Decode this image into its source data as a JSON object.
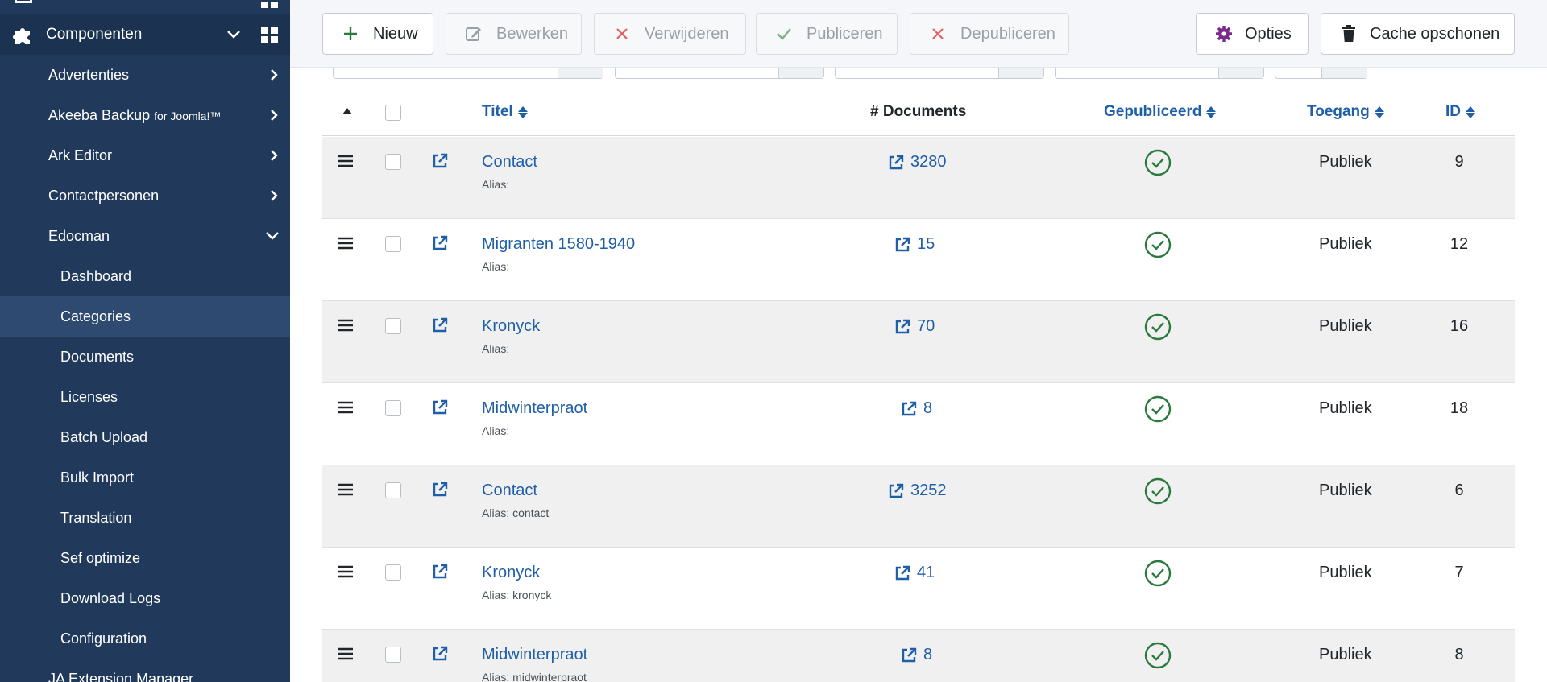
{
  "sidebar": {
    "section_label": "Componenten",
    "items": [
      {
        "label": "Advertenties",
        "level": 1,
        "icon": "chevron-right-icon"
      },
      {
        "label": "Akeeba Backup",
        "suffix": "for Joomla!™",
        "level": 1,
        "icon": "chevron-right-icon"
      },
      {
        "label": "Ark Editor",
        "level": 1,
        "icon": "chevron-right-icon"
      },
      {
        "label": "Contactpersonen",
        "level": 1,
        "icon": "chevron-right-icon"
      },
      {
        "label": "Edocman",
        "level": 1,
        "icon": "chevron-down-icon"
      },
      {
        "label": "Dashboard",
        "level": 2
      },
      {
        "label": "Categories",
        "level": 2,
        "active": true
      },
      {
        "label": "Documents",
        "level": 2
      },
      {
        "label": "Licenses",
        "level": 2
      },
      {
        "label": "Batch Upload",
        "level": 2
      },
      {
        "label": "Bulk Import",
        "level": 2
      },
      {
        "label": "Translation",
        "level": 2
      },
      {
        "label": "Sef optimize",
        "level": 2
      },
      {
        "label": "Download Logs",
        "level": 2
      },
      {
        "label": "Configuration",
        "level": 2
      },
      {
        "label": "JA Extension Manager",
        "level": 1
      }
    ]
  },
  "toolbar": {
    "new_label": "Nieuw",
    "edit_label": "Bewerken",
    "delete_label": "Verwijderen",
    "publish_label": "Publiceren",
    "unpublish_label": "Depubliceren",
    "options_label": "Opties",
    "cache_label": "Cache opschonen"
  },
  "table": {
    "headers": {
      "title": "Titel",
      "documents": "# Documents",
      "published": "Gepubliceerd",
      "access": "Toegang",
      "id": "ID"
    },
    "rows": [
      {
        "title": "Contact",
        "alias": "Alias:",
        "documents": "3280",
        "access": "Publiek",
        "id": "9"
      },
      {
        "title": "Migranten 1580-1940",
        "alias": "Alias:",
        "documents": "15",
        "access": "Publiek",
        "id": "12"
      },
      {
        "title": "Kronyck",
        "alias": "Alias:",
        "documents": "70",
        "access": "Publiek",
        "id": "16"
      },
      {
        "title": "Midwinterpraot",
        "alias": "Alias:",
        "documents": "8",
        "access": "Publiek",
        "id": "18"
      },
      {
        "title": "Contact",
        "alias": "Alias: contact",
        "documents": "3252",
        "access": "Publiek",
        "id": "6"
      },
      {
        "title": "Kronyck",
        "alias": "Alias: kronyck",
        "documents": "41",
        "access": "Publiek",
        "id": "7"
      },
      {
        "title": "Midwinterpraot",
        "alias": "Alias: midwinterpraot",
        "documents": "8",
        "access": "Publiek",
        "id": "8"
      }
    ]
  },
  "colors": {
    "sidebar_bg": "#213a5c",
    "link_blue": "#1f5fa8",
    "published_green": "#2a7a3f",
    "cross_red": "#e06060",
    "options_purple": "#7a2a8a"
  }
}
